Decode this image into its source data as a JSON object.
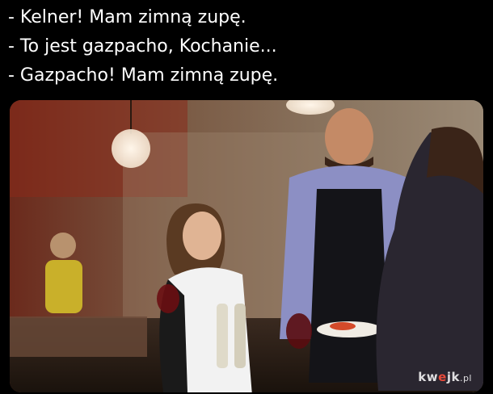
{
  "caption": {
    "lines": [
      "- Kelner! Mam zimną zupę.",
      "- To jest gazpacho, Kochanie...",
      "- Gazpacho! Mam zimną zupę."
    ]
  },
  "photo": {
    "subject": "waiter-serving-couple-restaurant-photo"
  },
  "watermark": {
    "brand_start": "kw",
    "brand_accent": "e",
    "brand_end": "jk",
    "tld": ".pl",
    "accent_color": "#e84a3a"
  },
  "colors": {
    "background": "#000000",
    "text": "#ffffff"
  }
}
